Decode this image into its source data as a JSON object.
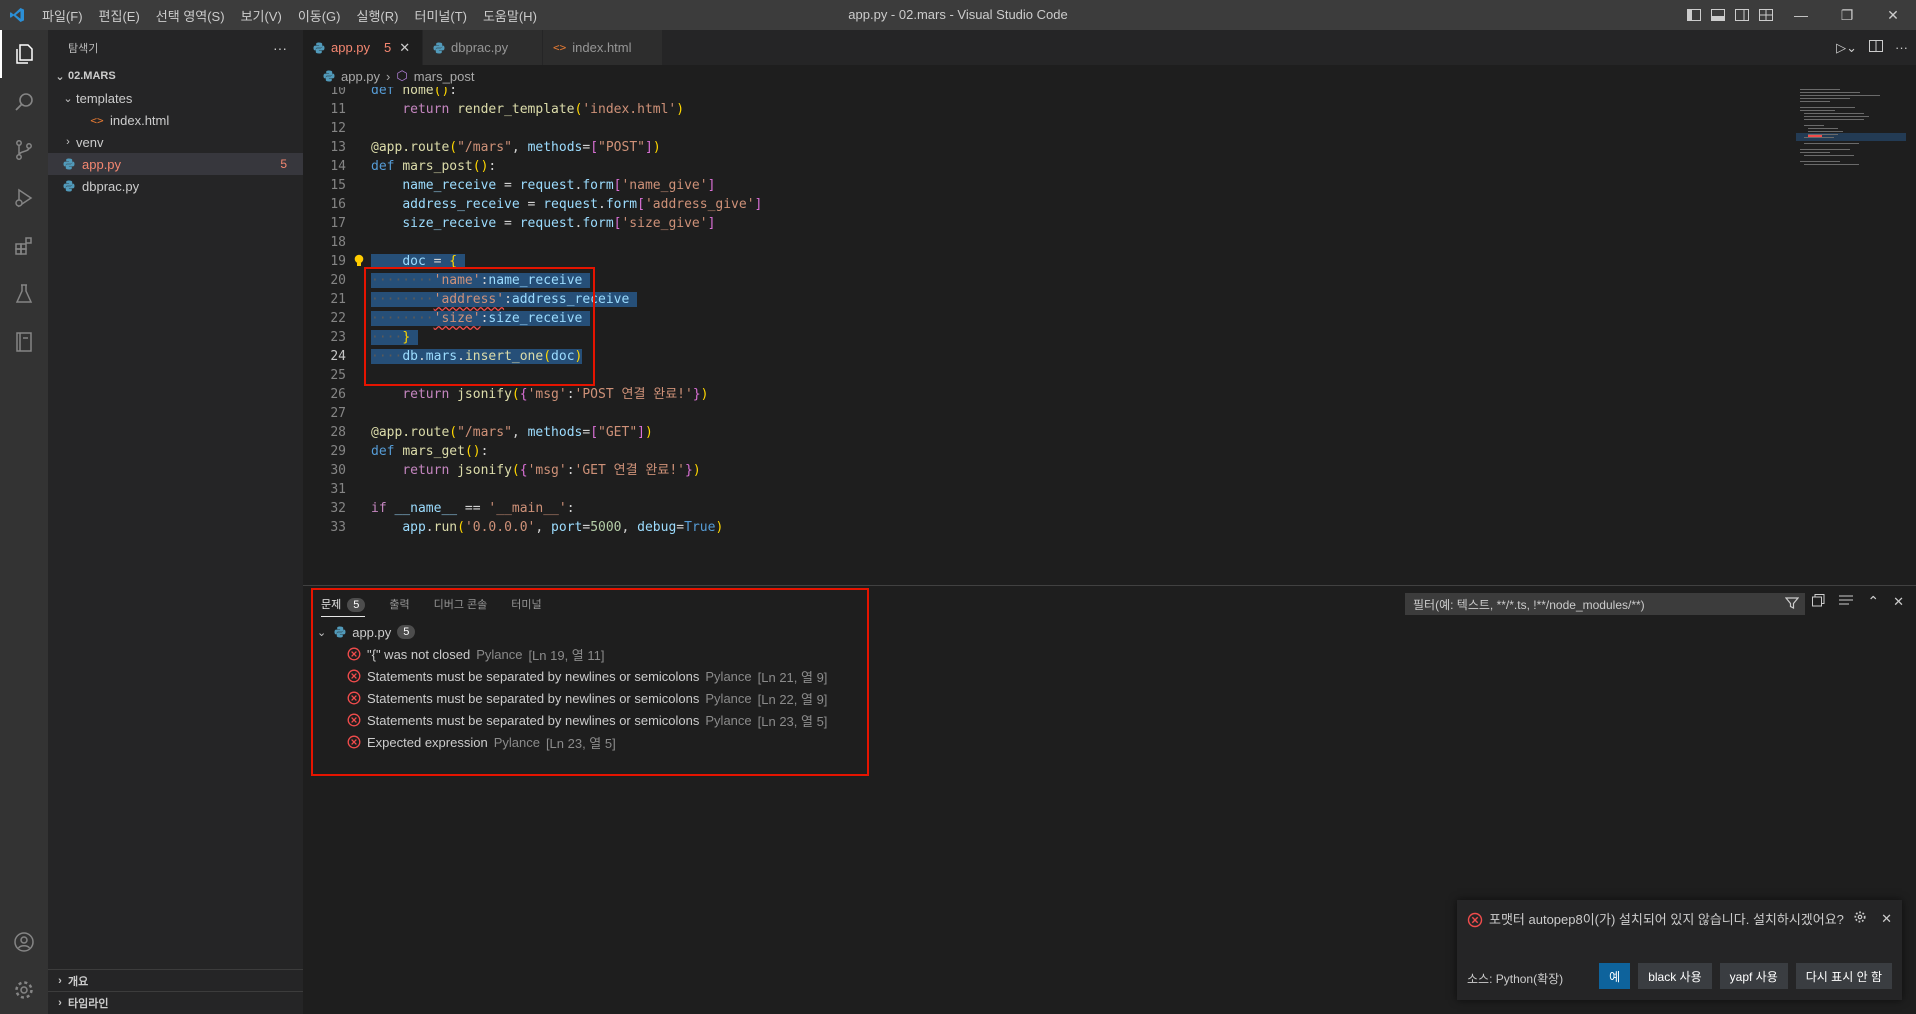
{
  "window": {
    "title": "app.py - 02.mars - Visual Studio Code",
    "menu": [
      "파일(F)",
      "편집(E)",
      "선택 영역(S)",
      "보기(V)",
      "이동(G)",
      "실행(R)",
      "터미널(T)",
      "도움말(H)"
    ]
  },
  "activity_bar": {
    "top": [
      "files-icon",
      "search-icon",
      "source-control-icon",
      "run-debug-icon",
      "extensions-icon",
      "testing-icon",
      "notebook-icon"
    ],
    "bottom": [
      "account-icon",
      "settings-gear-icon"
    ]
  },
  "sidebar": {
    "title": "탐색기",
    "more": "···",
    "root": "02.MARS",
    "items": [
      {
        "label": "templates"
      },
      {
        "label": "index.html"
      },
      {
        "label": "venv"
      },
      {
        "label": "app.py",
        "badge": "5"
      },
      {
        "label": "dbprac.py"
      }
    ],
    "bottom": [
      "개요",
      "타임라인"
    ]
  },
  "tabs": [
    {
      "label": "app.py",
      "count": "5",
      "close": "✕"
    },
    {
      "label": "dbprac.py"
    },
    {
      "label": "index.html"
    }
  ],
  "breadcrumb": {
    "file": "app.py",
    "sep": "›",
    "symbol": "mars_post"
  },
  "code": {
    "line_numbers": [
      "10",
      "11",
      "12",
      "13",
      "14",
      "15",
      "16",
      "17",
      "18",
      "19",
      "20",
      "21",
      "22",
      "23",
      "24",
      "25",
      "26",
      "27",
      "28",
      "29",
      "30",
      "31",
      "32",
      "33"
    ]
  },
  "panel": {
    "tabs": [
      {
        "label": "문제",
        "count": "5"
      },
      {
        "label": "출력"
      },
      {
        "label": "디버그 콘솔"
      },
      {
        "label": "터미널"
      }
    ],
    "filter_placeholder": "필터(예: 텍스트, **/*.ts, !**/node_modules/**)",
    "file": {
      "name": "app.py",
      "count": "5"
    },
    "problems": [
      {
        "message": "\"{\" was not closed",
        "source": "Pylance",
        "location": "[Ln 19, 열 11]"
      },
      {
        "message": "Statements must be separated by newlines or semicolons",
        "source": "Pylance",
        "location": "[Ln 21, 열 9]"
      },
      {
        "message": "Statements must be separated by newlines or semicolons",
        "source": "Pylance",
        "location": "[Ln 22, 열 9]"
      },
      {
        "message": "Statements must be separated by newlines or semicolons",
        "source": "Pylance",
        "location": "[Ln 23, 열 5]"
      },
      {
        "message": "Expected expression",
        "source": "Pylance",
        "location": "[Ln 23, 열 5]"
      }
    ]
  },
  "notification": {
    "message": "포맷터 autopep8이(가) 설치되어 있지 않습니다. 설치하시겠어요?",
    "source": "소스: Python(확장)",
    "buttons": [
      "예",
      "black 사용",
      "yapf 사용",
      "다시 표시 안 함"
    ]
  },
  "colors": {
    "accent": "#007acc",
    "error": "#f14c4c",
    "highlight_box": "#e51400",
    "python_icon": "#519aba",
    "html_icon": "#e37933"
  }
}
